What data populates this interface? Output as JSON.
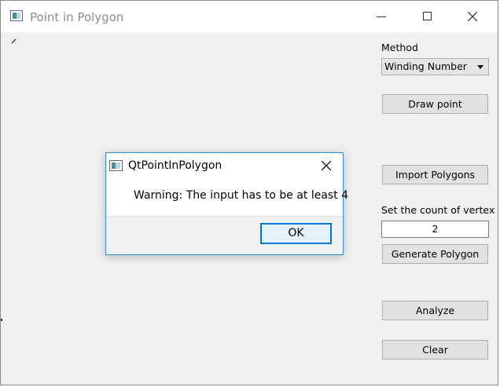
{
  "window": {
    "title": "Point in Polygon"
  },
  "sidebar": {
    "method_label": "Method",
    "method_value": "Winding Number",
    "draw_point_label": "Draw point",
    "import_polygons_label": "Import Polygons",
    "vertex_count_label": "Set the count of vertex",
    "vertex_count_value": "2",
    "generate_polygon_label": "Generate Polygon",
    "analyze_label": "Analyze",
    "clear_label": "Clear"
  },
  "dialog": {
    "title": "QtPointInPolygon",
    "message": "Warning: The input has to be at least 4",
    "ok_label": "OK"
  },
  "colors": {
    "accent": "#0078d7",
    "dialog_border": "#3d8fd1",
    "window_bg": "#f0f0f0"
  }
}
